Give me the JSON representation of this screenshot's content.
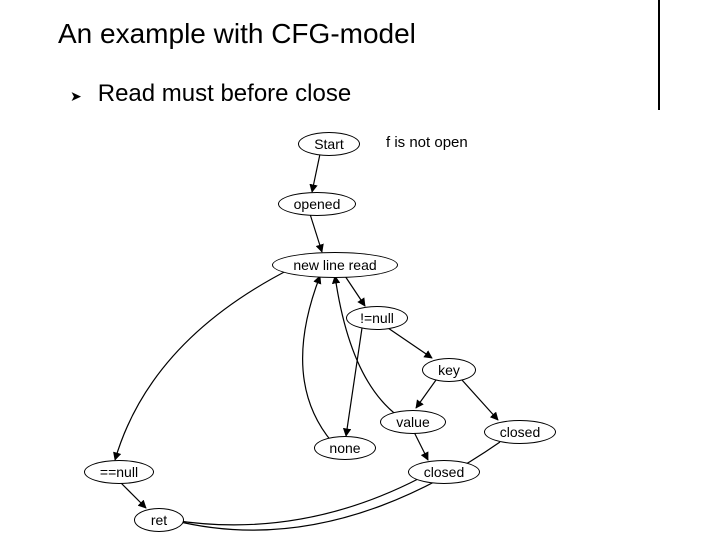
{
  "title": "An example with CFG-model",
  "bullet": {
    "glyph": "➤",
    "text": "Read must before close"
  },
  "side_label": "f is not open",
  "nodes": {
    "start": "Start",
    "opened": "opened",
    "newline": "new line read",
    "notnull": "!=null",
    "key": "key",
    "value": "value",
    "none": "none",
    "closed1": "closed",
    "closed2": "closed",
    "eqnull": "==null",
    "ret": "ret"
  }
}
